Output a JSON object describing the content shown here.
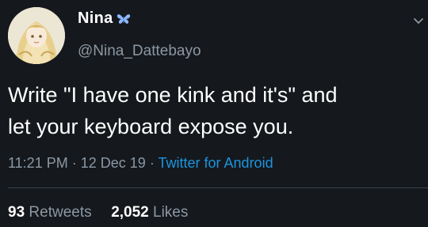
{
  "user": {
    "display_name": "Nina",
    "handle": "@Nina_Dattebayo",
    "name_icon": "butterfly-icon"
  },
  "tweet": {
    "text_line1": "Write \"I have one kink and it's\" and",
    "text_line2": "let your keyboard expose you."
  },
  "meta": {
    "time": "11:21 PM",
    "separator": "·",
    "date": "12 Dec 19",
    "source": "Twitter for Android"
  },
  "stats": {
    "retweets_count": "93",
    "retweets_label": "Retweets",
    "likes_count": "2,052",
    "likes_label": "Likes"
  },
  "colors": {
    "background": "#15181c",
    "secondary_text": "#8b98a5",
    "link": "#1b95e0"
  }
}
